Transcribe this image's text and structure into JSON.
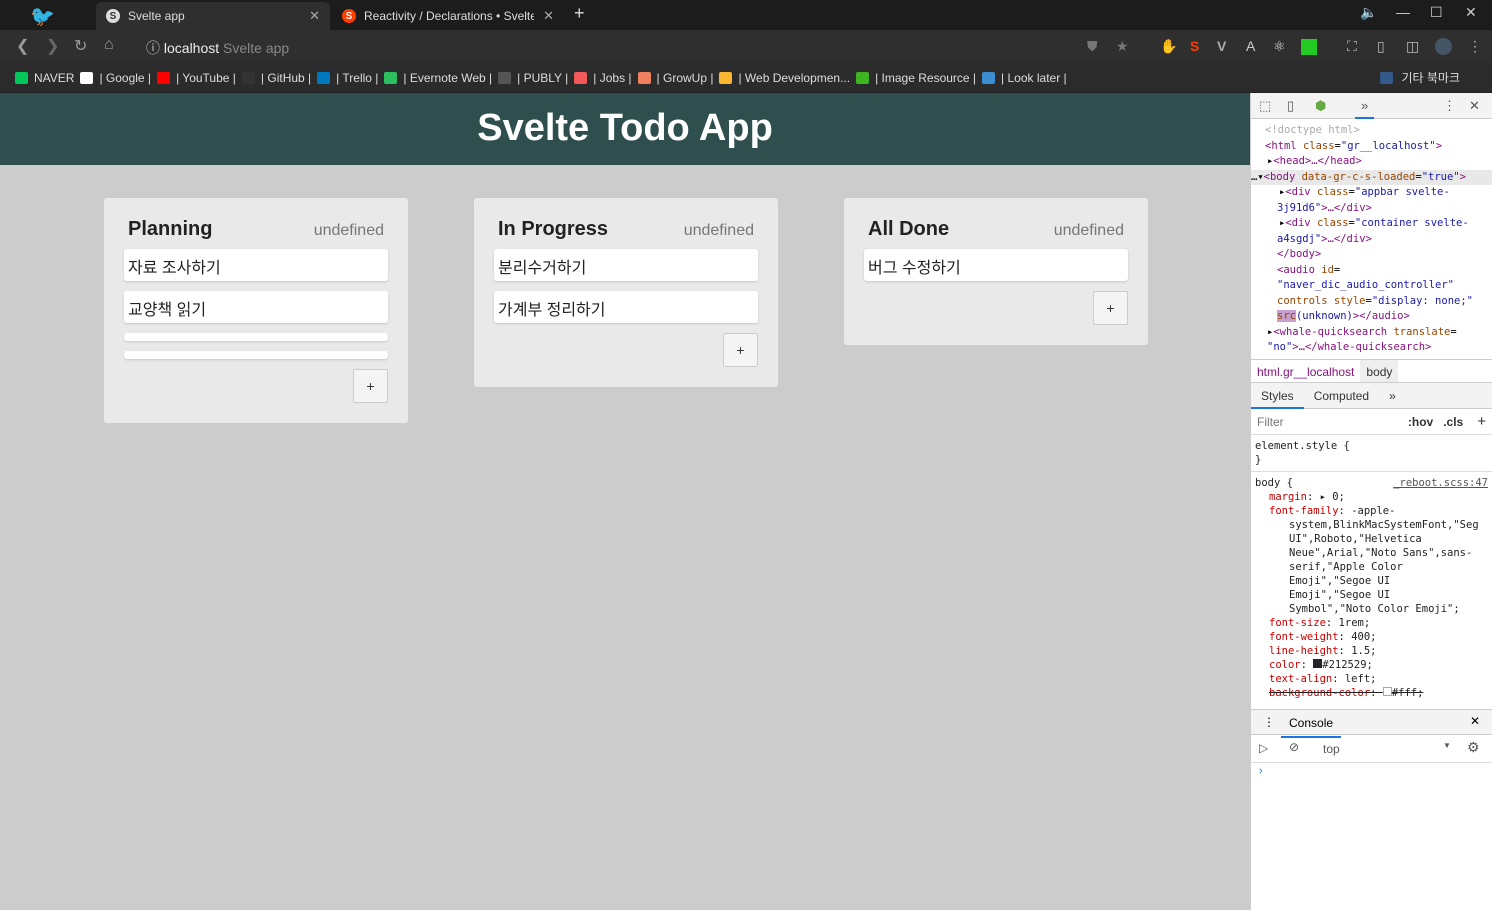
{
  "browser": {
    "tabs": [
      {
        "title": "Svelte app",
        "active": true
      },
      {
        "title": "Reactivity / Declarations • Svelte",
        "active": false
      }
    ],
    "new_tab": "+",
    "url_host": "localhost",
    "url_title": "Svelte app",
    "bookmarks": [
      {
        "label": "NAVER",
        "color": "#03c75a"
      },
      {
        "label": "| Google |",
        "color": "#ffffff"
      },
      {
        "label": "| YouTube |",
        "color": "#ff0000"
      },
      {
        "label": "| GitHub |",
        "color": "#333333"
      },
      {
        "label": "| Trello |",
        "color": "#0079bf"
      },
      {
        "label": "| Evernote Web |",
        "color": "#2dbe60"
      },
      {
        "label": "| PUBLY |",
        "color": "#555555"
      },
      {
        "label": "| Jobs |",
        "color": "#f25a5a"
      },
      {
        "label": "| GrowUp |",
        "color": "#f08060"
      },
      {
        "label": "| Web Developmen...",
        "color": "#fbb731"
      },
      {
        "label": "| Image Resource |",
        "color": "#3cb521"
      },
      {
        "label": "| Look later |",
        "color": "#3d8ed1"
      }
    ],
    "other_bookmarks": "기타 북마크"
  },
  "app": {
    "title": "Svelte Todo App",
    "columns": [
      {
        "title": "Planning",
        "count": "undefined",
        "cards": [
          "자료 조사하기",
          "교양책 읽기",
          "",
          ""
        ]
      },
      {
        "title": "In Progress",
        "count": "undefined",
        "cards": [
          "분리수거하기",
          "가계부 정리하기"
        ]
      },
      {
        "title": "All Done",
        "count": "undefined",
        "cards": [
          "버그 수정하기"
        ]
      }
    ],
    "add_label": "+"
  },
  "devtools": {
    "crumbs": [
      "html.gr__localhost",
      "body"
    ],
    "style_tabs": [
      "Styles",
      "Computed"
    ],
    "filter_placeholder": "Filter",
    "hov": ":hov",
    "cls": ".cls",
    "element_style": "element.style {",
    "source": "_reboot.scss:47",
    "console_tab": "Console",
    "context": "top"
  }
}
